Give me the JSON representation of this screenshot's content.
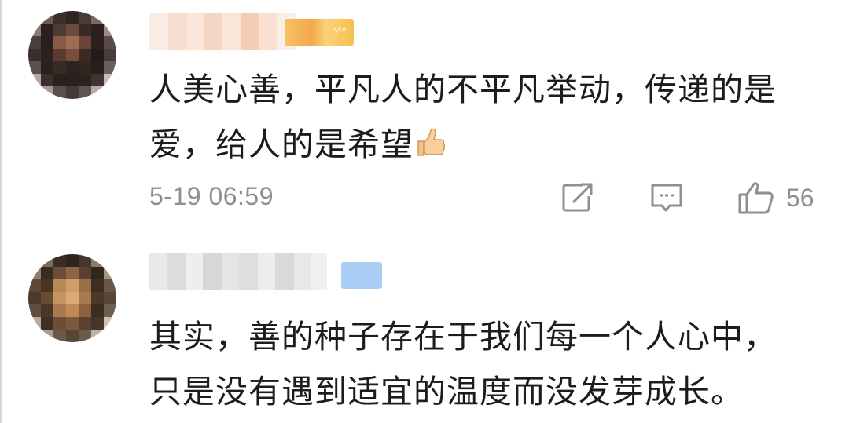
{
  "comments": [
    {
      "text_line_1": "人美心善，平凡人的不平凡举动，传递的是",
      "text_line_2": "爱，给人的是希望",
      "emoji": "thumbs-up",
      "timestamp": "5-19 06:59",
      "like_count": "56",
      "badge_text": "ᵗ⁄¹⁰"
    },
    {
      "text_line_1": "其实，善的种子存在于我们每一个人心中，",
      "text_line_2": "只是没有遇到适宜的温度而没发芽成长。"
    }
  ],
  "icons": {
    "forward": "share-icon",
    "reply": "comment-icon",
    "like": "thumbs-up-icon"
  },
  "colors": {
    "meta_gray": "#8f8f8f",
    "text": "#1c1c1c",
    "divider": "#e6e6e6",
    "badge_gold": "#f5a84c",
    "badge_blue": "#a9cdf5"
  }
}
